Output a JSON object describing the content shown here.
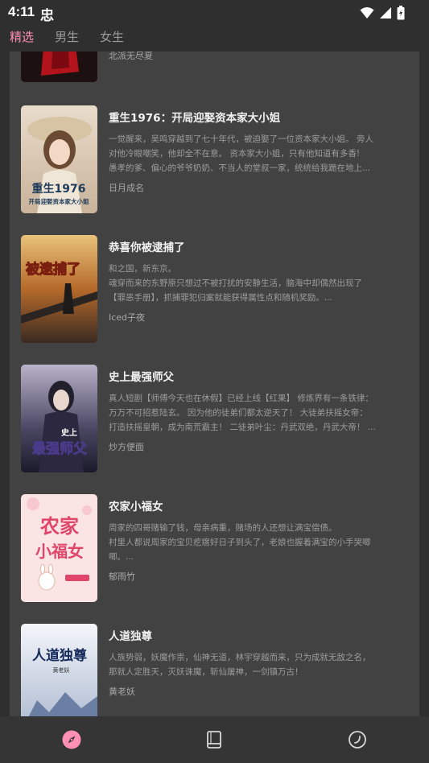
{
  "status_bar": {
    "time": "4:11",
    "notification_glyph": "忠",
    "icons": [
      "wifi-icon",
      "signal-icon",
      "battery-icon"
    ]
  },
  "tabs": [
    {
      "label": "精选",
      "active": true
    },
    {
      "label": "男生",
      "active": false
    },
    {
      "label": "女生",
      "active": false
    }
  ],
  "partial_book": {
    "author": "北派无尽夏"
  },
  "books": [
    {
      "title": "重生1976：开局迎娶资本家大小姐",
      "intro": [
        "一觉醒来，吴鸣穿越到了七十年代，被迫娶了一位资本家大小姐。 旁人",
        "对他冷眼嘲笑，他却全不在意。 资本家大小姐，只有他知道有多香!",
        "愚孝的爹、偏心的爷爷奶奶、不当人的堂叔一家，统统给我跪在地上..."
      ],
      "author": "日月成名",
      "cover_text": [
        "重生1976",
        "开局迎娶资本家大小姐"
      ]
    },
    {
      "title": "恭喜你被逮捕了",
      "intro": [
        "和之国，新东京。",
        "魂穿而来的东野原只想过不被打扰的安静生活，脑海中却偶然出现了",
        "【罪恶手册】，抓捕罪犯归案就能获得属性点和随机奖励。..."
      ],
      "author": "Iced子夜",
      "cover_text": [
        "被逮捕了"
      ]
    },
    {
      "title": "史上最强师父",
      "intro": [
        "真人短剧【师傅今天也在休假】已经上线【红果】 修炼界有一条铁律：",
        "万万不可招惹陆玄。 因为他的徒弟们都太逆天了！ 大徒弟扶摇女帝：",
        "打造扶摇皇朝，成为南荒霸主！ 二徒弟叶尘：丹武双绝，丹武大帝！ ..."
      ],
      "author": "炒方便面",
      "cover_text": [
        "史上",
        "最强师父"
      ]
    },
    {
      "title": "农家小福女",
      "intro": [
        "周家的四哥赌输了钱，母亲病重，赌场的人还想让满宝偿债。",
        "村里人都说周家的宝贝疙瘩好日子到头了，老娘也握着满宝的小手哭唧",
        "唧。..."
      ],
      "author": "郁雨竹",
      "cover_text": [
        "农家",
        "小福女"
      ]
    },
    {
      "title": "人道独尊",
      "intro": [
        "人族势弱，妖魔作祟，仙神无道，林宇穿越而来，只为成就无敌之名，",
        "那就人定胜天，灭妖诛魔，斩仙屠神，一剑镇万古！"
      ],
      "author": "黄老妖",
      "cover_text": [
        "人道独尊",
        "黄老妖"
      ]
    }
  ],
  "bottom_nav": [
    {
      "name": "discover-icon",
      "active": true
    },
    {
      "name": "bookshelf-icon",
      "active": false
    },
    {
      "name": "history-icon",
      "active": false
    }
  ],
  "colors": {
    "accent": "#ff8fb5",
    "background": "#2f2f2f",
    "panel": "#424242",
    "nav_bar": "#353535"
  }
}
